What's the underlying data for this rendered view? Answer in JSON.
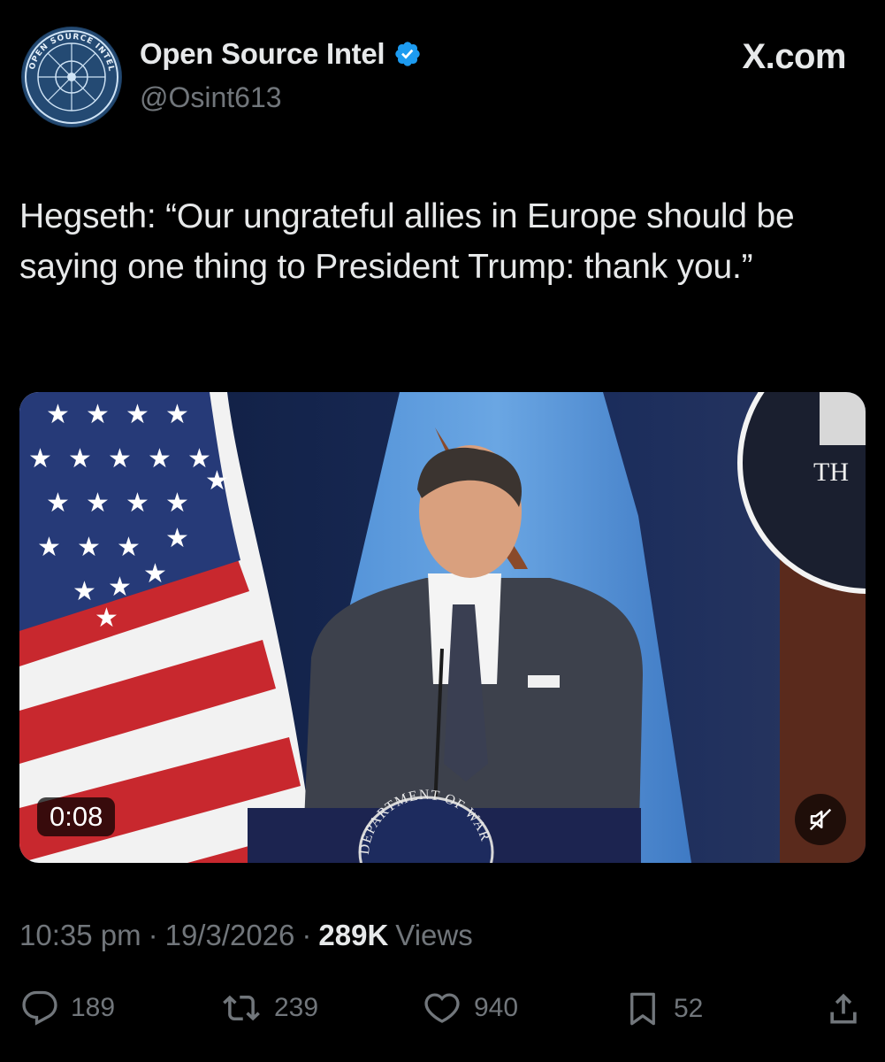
{
  "author": {
    "display_name": "Open Source Intel",
    "handle": "@Osint613",
    "verified": true,
    "avatar_ring_text": "OPEN SOURCE INTEL"
  },
  "brand": "X.com",
  "tweet": {
    "text": "Hegseth: “Our ungrateful allies in Europe should be saying one thing to President Trump: thank you.”"
  },
  "video": {
    "duration": "0:08",
    "podium_seal_text": "DEPARTMENT OF WAR",
    "background_seal_text": "TH",
    "muted": true
  },
  "meta": {
    "time": "10:35 pm",
    "date": "19/3/2026",
    "views_count": "289K",
    "views_label": "Views"
  },
  "actions": {
    "replies": "189",
    "reposts": "239",
    "likes": "940",
    "bookmarks": "52"
  },
  "colors": {
    "background": "#000000",
    "text_primary": "#e7e9ea",
    "text_secondary": "#71767b",
    "verified_blue": "#1d9bf0"
  },
  "icons": [
    "verified-badge-icon",
    "mute-icon",
    "reply-icon",
    "repost-icon",
    "like-icon",
    "bookmark-icon",
    "share-icon"
  ]
}
